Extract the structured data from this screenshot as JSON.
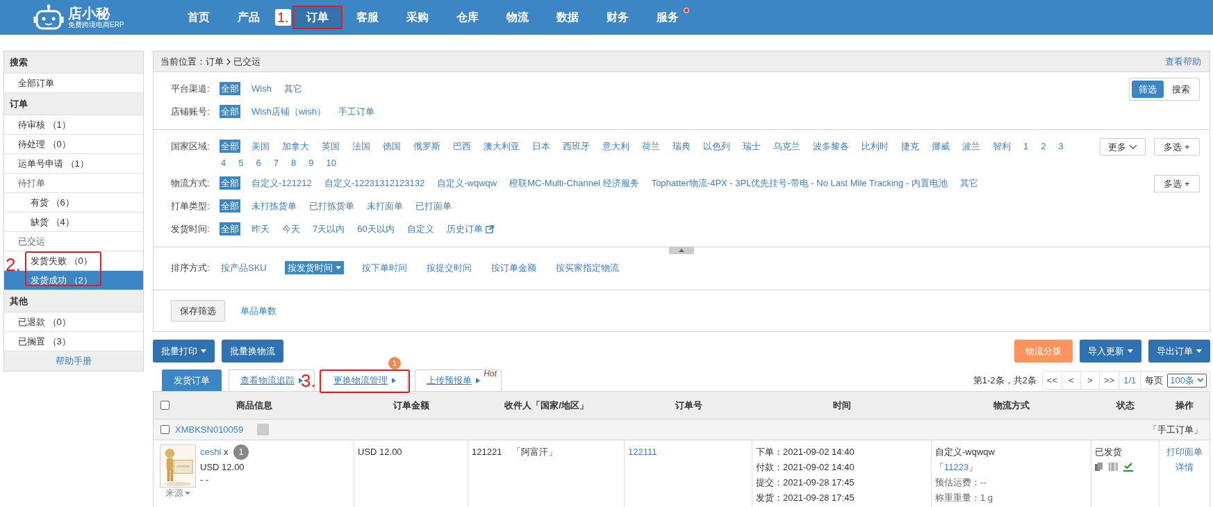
{
  "header": {
    "logo_text": "店小秘",
    "logo_subtitle": "免费跨境电商ERP",
    "nav": [
      {
        "label": "首页",
        "selected": false,
        "dot": false
      },
      {
        "label": "产品",
        "selected": false,
        "dot": false
      },
      {
        "label": "订单",
        "selected": true,
        "dot": false,
        "callout": "1."
      },
      {
        "label": "客服",
        "selected": false,
        "dot": false
      },
      {
        "label": "采购",
        "selected": false,
        "dot": false
      },
      {
        "label": "仓库",
        "selected": false,
        "dot": false
      },
      {
        "label": "物流",
        "selected": false,
        "dot": false
      },
      {
        "label": "数据",
        "selected": false,
        "dot": false
      },
      {
        "label": "财务",
        "selected": false,
        "dot": false
      },
      {
        "label": "服务",
        "selected": false,
        "dot": true
      }
    ]
  },
  "sidebar": {
    "sections": [
      {
        "title": "搜索",
        "items": [
          {
            "label": "全部订单",
            "selected": false
          }
        ]
      },
      {
        "title": "订单",
        "items": [
          {
            "label": "待审核 （1）",
            "selected": false
          },
          {
            "label": "待处理 （0）",
            "selected": false
          },
          {
            "label": "运单号申请 （1）",
            "selected": false
          },
          {
            "label": "待打单",
            "selected": false,
            "children": [
              {
                "label": "有货 （6）",
                "selected": false
              },
              {
                "label": "缺货 （4）",
                "selected": false
              }
            ]
          },
          {
            "label": "已交运",
            "selected": false,
            "callout": "2.",
            "children": [
              {
                "label": "发货失败 （0）",
                "selected": false
              },
              {
                "label": "发货成功 （2）",
                "selected": true
              }
            ]
          }
        ]
      },
      {
        "title": "其他",
        "items": [
          {
            "label": "已退款 （0）",
            "selected": false
          },
          {
            "label": "已搁置 （3）",
            "selected": false
          }
        ]
      }
    ],
    "help": "帮助手册"
  },
  "breadcrumb": {
    "label": "当前位置：",
    "path": [
      "订单",
      "已交运"
    ],
    "help": "查看帮助"
  },
  "mode_toggle": [
    {
      "label": "筛选",
      "selected": true
    },
    {
      "label": "搜索",
      "selected": false
    }
  ],
  "filter_groups": [
    [
      {
        "label": "平台渠道:",
        "options": [
          {
            "label": "全部",
            "selected": true
          },
          {
            "label": "Wish",
            "selected": false
          },
          {
            "label": "其它",
            "selected": false
          }
        ]
      },
      {
        "label": "店铺账号:",
        "options": [
          {
            "label": "全部",
            "selected": true
          },
          {
            "label": "Wish店铺（wish）",
            "selected": false
          },
          {
            "label": "手工订单",
            "selected": false
          }
        ]
      }
    ],
    [
      {
        "label": "国家区域:",
        "more": "更多",
        "multi": "多选 +",
        "options": [
          {
            "label": "全部",
            "selected": true
          },
          {
            "label": "美国",
            "selected": false
          },
          {
            "label": "加拿大",
            "selected": false
          },
          {
            "label": "英国",
            "selected": false
          },
          {
            "label": "法国",
            "selected": false
          },
          {
            "label": "德国",
            "selected": false
          },
          {
            "label": "俄罗斯",
            "selected": false
          },
          {
            "label": "巴西",
            "selected": false
          },
          {
            "label": "澳大利亚",
            "selected": false
          },
          {
            "label": "日本",
            "selected": false
          },
          {
            "label": "西班牙",
            "selected": false
          },
          {
            "label": "意大利",
            "selected": false
          },
          {
            "label": "荷兰",
            "selected": false
          },
          {
            "label": "瑞典",
            "selected": false
          },
          {
            "label": "以色列",
            "selected": false
          },
          {
            "label": "瑞士",
            "selected": false
          },
          {
            "label": "乌克兰",
            "selected": false
          },
          {
            "label": "波多黎各",
            "selected": false
          },
          {
            "label": "比利时",
            "selected": false
          },
          {
            "label": "捷克",
            "selected": false
          },
          {
            "label": "挪威",
            "selected": false
          },
          {
            "label": "波兰",
            "selected": false
          },
          {
            "label": "智利",
            "selected": false
          },
          {
            "label": "1",
            "selected": false
          },
          {
            "label": "2",
            "selected": false
          },
          {
            "label": "3",
            "selected": false
          },
          {
            "label": "4",
            "selected": false
          },
          {
            "label": "5",
            "selected": false
          },
          {
            "label": "6",
            "selected": false
          },
          {
            "label": "7",
            "selected": false
          },
          {
            "label": "8",
            "selected": false
          },
          {
            "label": "9",
            "selected": false
          },
          {
            "label": "10",
            "selected": false
          }
        ]
      },
      {
        "label": "物流方式:",
        "multi": "多选 +",
        "options": [
          {
            "label": "全部",
            "selected": true
          },
          {
            "label": "自定义-121212",
            "selected": false
          },
          {
            "label": "自定义-12231312123132",
            "selected": false
          },
          {
            "label": "自定义-wqwqw",
            "selected": false
          },
          {
            "label": "橙联MC-Multi-Channel 经济服务",
            "selected": false
          },
          {
            "label": "Tophatter物流-4PX - 3PL优先挂号-带电 - No Last Mile Tracking - 内置电池",
            "selected": false
          },
          {
            "label": "其它",
            "selected": false
          }
        ]
      },
      {
        "label": "打单类型:",
        "options": [
          {
            "label": "全部",
            "selected": true
          },
          {
            "label": "未打拣货单",
            "selected": false
          },
          {
            "label": "已打拣货单",
            "selected": false
          },
          {
            "label": "未打面单",
            "selected": false
          },
          {
            "label": "已打面单",
            "selected": false
          }
        ]
      },
      {
        "label": "发货时间:",
        "options": [
          {
            "label": "全部",
            "selected": true
          },
          {
            "label": "昨天",
            "selected": false
          },
          {
            "label": "今天",
            "selected": false
          },
          {
            "label": "7天以内",
            "selected": false
          },
          {
            "label": "60天以内",
            "selected": false
          },
          {
            "label": "自定义",
            "selected": false
          },
          {
            "label": "历史订单",
            "selected": false,
            "external": true
          }
        ]
      }
    ]
  ],
  "sort": {
    "label": "排序方式:",
    "options": [
      {
        "label": "按产品SKU",
        "selected": false
      },
      {
        "label": "按发货时间",
        "selected": true
      },
      {
        "label": "按下单时间",
        "selected": false
      },
      {
        "label": "按提交时间",
        "selected": false
      },
      {
        "label": "按订单金额",
        "selected": false
      },
      {
        "label": "按买家指定物流",
        "selected": false
      }
    ]
  },
  "save_button": "保存筛选",
  "save_link": "单品单数",
  "actions_left": [
    {
      "label": "批量打印",
      "kind": "blue",
      "dropdown": true
    },
    {
      "label": "批量换物流",
      "kind": "blue",
      "dropdown": false
    }
  ],
  "actions_right": [
    {
      "label": "物流分拨",
      "kind": "orange",
      "dropdown": false
    },
    {
      "label": "导入更新",
      "kind": "blue",
      "dropdown": true
    },
    {
      "label": "导出订单",
      "kind": "blue",
      "dropdown": true
    }
  ],
  "tabs": [
    {
      "label": "发货订单",
      "selected": true,
      "arrow": false
    },
    {
      "label": "查看物流追踪",
      "selected": false,
      "arrow": true
    },
    {
      "label": "更换物流管理",
      "selected": false,
      "arrow": true,
      "badge": "1",
      "callout": "3."
    },
    {
      "label": "上传预报单",
      "selected": false,
      "arrow": true,
      "hot": "Hot"
    }
  ],
  "pagination": {
    "summary": "第1-2条，共2条",
    "buttons": [
      "<<",
      "<",
      ">",
      ">>"
    ],
    "page": "1/1",
    "per_page_label": "每页",
    "per_page": "100条"
  },
  "table": {
    "select_all_checked": false,
    "columns": [
      "商品信息",
      "订单金额",
      "收件人「国家/地区」",
      "订单号",
      "时间",
      "物流方式",
      "状态",
      "操作"
    ],
    "groups": [
      {
        "order_id": "XMBKSN010059",
        "checked": false,
        "source": "「手工订单」",
        "rows": [
          {
            "product": {
              "kind": "picture",
              "name": "ceshi",
              "times": "x",
              "qty": "1",
              "price": "USD 12.00",
              "sku": "- -",
              "source_menu": "来源"
            },
            "amount": "USD 12.00",
            "recipient": "121221",
            "country": "「阿富汗」",
            "order_no": "122111",
            "times": [
              "下单：2021-09-02 14:40",
              "付款：2021-09-02 14:40",
              "提交：2021-09-28 17:45",
              "发货：2021-09-28 17:45"
            ],
            "logistics": {
              "method": "自定义-wqwqw",
              "tracking_open": "「",
              "tracking": "11223",
              "tracking_close": "」",
              "estimate": "预估运费：--",
              "weight": "称重重量：1 g"
            },
            "status": "已发货",
            "operations": [
              "打印面单",
              "详情"
            ]
          }
        ]
      }
    ]
  }
}
